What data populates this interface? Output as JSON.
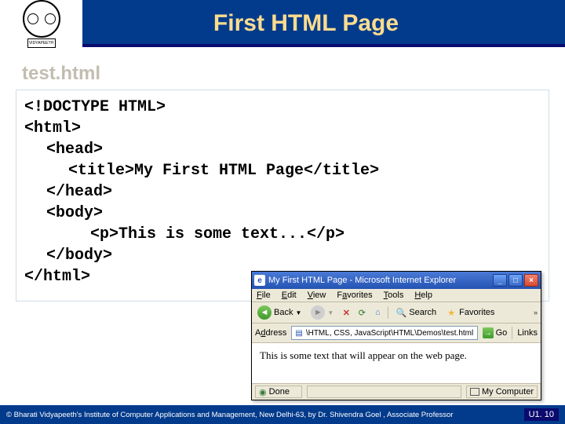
{
  "header": {
    "title": "First HTML Page"
  },
  "filename": "test.html",
  "code": {
    "l1": "<!DOCTYPE HTML>",
    "l2": "<html>",
    "l3": "<head>",
    "l4": "<title>My First HTML Page</title>",
    "l5": "</head>",
    "l6": "<body>",
    "l7": "<p>This is some text...</p>",
    "l8": "</body>",
    "l9": "</html>"
  },
  "browser": {
    "title": "My First HTML Page - Microsoft Internet Explorer",
    "menu": {
      "file": "File",
      "edit": "Edit",
      "view": "View",
      "favorites": "Favorites",
      "tools": "Tools",
      "help": "Help"
    },
    "toolbar": {
      "back": "Back",
      "search": "Search",
      "favorites": "Favorites",
      "more": "»"
    },
    "address": {
      "label": "Address",
      "path": "\\HTML, CSS, JavaScript\\HTML\\Demos\\test.html",
      "go": "Go",
      "links": "Links"
    },
    "content": "This is some text that will appear on the web page.",
    "status": {
      "done": "Done",
      "zone": "My Computer"
    }
  },
  "footer": {
    "copyright": "© Bharati Vidyapeeth's Institute of Computer Applications and Management, New Delhi-63, by Dr. Shivendra Goel , Associate Professor",
    "slide_number": "U1. 10"
  }
}
